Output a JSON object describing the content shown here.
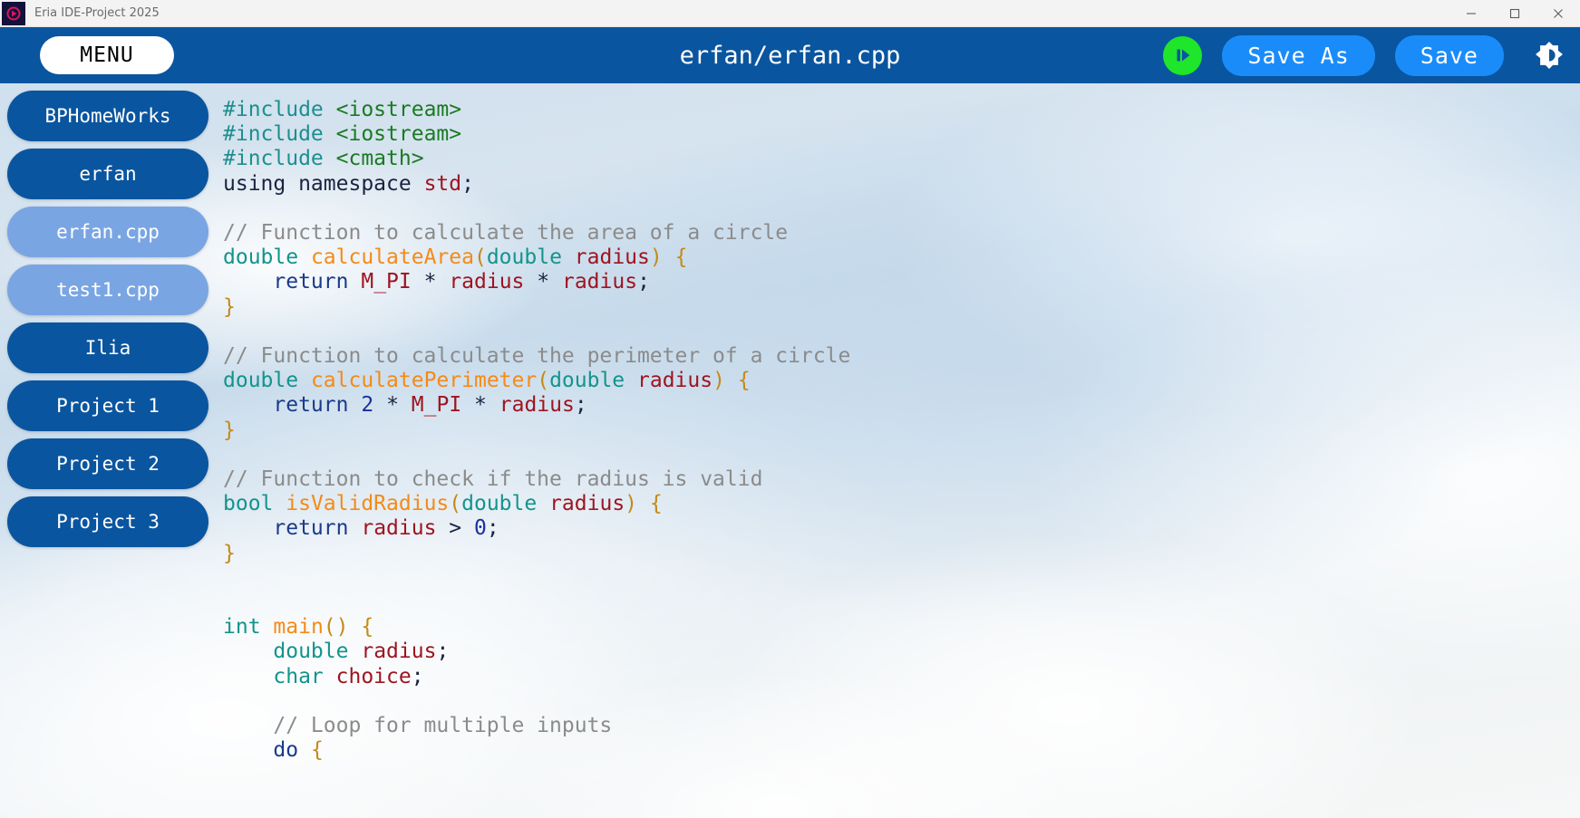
{
  "window": {
    "title": "Eria IDE-Project 2025",
    "icon": "app-logo-icon",
    "controls": {
      "minimize": "minimize-icon",
      "maximize": "maximize-icon",
      "close": "close-icon"
    }
  },
  "toolbar": {
    "menu_label": "MENU",
    "file_title": "erfan/erfan.cpp",
    "run_icon": "run-play-icon",
    "save_as_label": "Save As",
    "save_label": "Save",
    "theme_icon": "brightness-toggle-icon",
    "colors": {
      "bar_background": "#0a559f",
      "menu_background": "#ffffff",
      "pill_background": "#1a8cfa",
      "run_background": "#1fe62a"
    }
  },
  "sidebar": {
    "items": [
      {
        "label": "BPHomeWorks",
        "type": "folder"
      },
      {
        "label": "erfan",
        "type": "folder"
      },
      {
        "label": "erfan.cpp",
        "type": "file"
      },
      {
        "label": "test1.cpp",
        "type": "file"
      },
      {
        "label": "Ilia",
        "type": "folder"
      },
      {
        "label": "Project 1",
        "type": "folder"
      },
      {
        "label": "Project 2",
        "type": "folder"
      },
      {
        "label": "Project 3",
        "type": "folder"
      }
    ],
    "colors": {
      "folder": "#0a559f",
      "file": "#7aa5e3"
    }
  },
  "editor": {
    "language": "cpp",
    "lines": [
      [
        [
          "#include",
          "pre"
        ],
        [
          " ",
          "plain"
        ],
        [
          "<iostream>",
          "hdr"
        ]
      ],
      [
        [
          "#include",
          "pre"
        ],
        [
          " ",
          "plain"
        ],
        [
          "<iostream>",
          "hdr"
        ]
      ],
      [
        [
          "#include",
          "pre"
        ],
        [
          " ",
          "plain"
        ],
        [
          "<cmath>",
          "hdr"
        ]
      ],
      [
        [
          "using namespace ",
          "plain"
        ],
        [
          "std",
          "var"
        ],
        [
          ";",
          "plain"
        ]
      ],
      [
        [
          "",
          "plain"
        ]
      ],
      [
        [
          "// Function to calculate the area of a circle",
          "cmt"
        ]
      ],
      [
        [
          "double",
          "type"
        ],
        [
          " ",
          "plain"
        ],
        [
          "calculateArea",
          "fn"
        ],
        [
          "(",
          "brace"
        ],
        [
          "double",
          "type"
        ],
        [
          " ",
          "plain"
        ],
        [
          "radius",
          "var"
        ],
        [
          ")",
          "brace"
        ],
        [
          " ",
          "plain"
        ],
        [
          "{",
          "brace"
        ]
      ],
      [
        [
          "    ",
          "plain"
        ],
        [
          "return",
          "kw"
        ],
        [
          " ",
          "plain"
        ],
        [
          "M_PI",
          "var"
        ],
        [
          " ",
          "plain"
        ],
        [
          "*",
          "plain"
        ],
        [
          " ",
          "plain"
        ],
        [
          "radius",
          "var"
        ],
        [
          " ",
          "plain"
        ],
        [
          "*",
          "plain"
        ],
        [
          " ",
          "plain"
        ],
        [
          "radius",
          "var"
        ],
        [
          ";",
          "plain"
        ]
      ],
      [
        [
          "}",
          "brace"
        ]
      ],
      [
        [
          "",
          "plain"
        ]
      ],
      [
        [
          "// Function to calculate the perimeter of a circle",
          "cmt"
        ]
      ],
      [
        [
          "double",
          "type"
        ],
        [
          " ",
          "plain"
        ],
        [
          "calculatePerimeter",
          "fn"
        ],
        [
          "(",
          "brace"
        ],
        [
          "double",
          "type"
        ],
        [
          " ",
          "plain"
        ],
        [
          "radius",
          "var"
        ],
        [
          ")",
          "brace"
        ],
        [
          " ",
          "plain"
        ],
        [
          "{",
          "brace"
        ]
      ],
      [
        [
          "    ",
          "plain"
        ],
        [
          "return",
          "kw"
        ],
        [
          " ",
          "plain"
        ],
        [
          "2",
          "num"
        ],
        [
          " ",
          "plain"
        ],
        [
          "*",
          "plain"
        ],
        [
          " ",
          "plain"
        ],
        [
          "M_PI",
          "var"
        ],
        [
          " ",
          "plain"
        ],
        [
          "*",
          "plain"
        ],
        [
          " ",
          "plain"
        ],
        [
          "radius",
          "var"
        ],
        [
          ";",
          "plain"
        ]
      ],
      [
        [
          "}",
          "brace"
        ]
      ],
      [
        [
          "",
          "plain"
        ]
      ],
      [
        [
          "// Function to check if the radius is valid",
          "cmt"
        ]
      ],
      [
        [
          "bool",
          "type"
        ],
        [
          " ",
          "plain"
        ],
        [
          "isValidRadius",
          "fn"
        ],
        [
          "(",
          "brace"
        ],
        [
          "double",
          "type"
        ],
        [
          " ",
          "plain"
        ],
        [
          "radius",
          "var"
        ],
        [
          ")",
          "brace"
        ],
        [
          " ",
          "plain"
        ],
        [
          "{",
          "brace"
        ]
      ],
      [
        [
          "    ",
          "plain"
        ],
        [
          "return",
          "kw"
        ],
        [
          " ",
          "plain"
        ],
        [
          "radius",
          "var"
        ],
        [
          " ",
          "plain"
        ],
        [
          ">",
          "plain"
        ],
        [
          " ",
          "plain"
        ],
        [
          "0",
          "num"
        ],
        [
          ";",
          "plain"
        ]
      ],
      [
        [
          "}",
          "brace"
        ]
      ],
      [
        [
          "",
          "plain"
        ]
      ],
      [
        [
          "",
          "plain"
        ]
      ],
      [
        [
          "int",
          "type"
        ],
        [
          " ",
          "plain"
        ],
        [
          "main",
          "fn"
        ],
        [
          "()",
          "brace"
        ],
        [
          " ",
          "plain"
        ],
        [
          "{",
          "brace"
        ]
      ],
      [
        [
          "    ",
          "plain"
        ],
        [
          "double",
          "type"
        ],
        [
          " ",
          "plain"
        ],
        [
          "radius",
          "var"
        ],
        [
          ";",
          "plain"
        ]
      ],
      [
        [
          "    ",
          "plain"
        ],
        [
          "char",
          "type"
        ],
        [
          " ",
          "plain"
        ],
        [
          "choice",
          "var"
        ],
        [
          ";",
          "plain"
        ]
      ],
      [
        [
          "",
          "plain"
        ]
      ],
      [
        [
          "    ",
          "plain"
        ],
        [
          "// Loop for multiple inputs",
          "cmt"
        ]
      ],
      [
        [
          "    ",
          "plain"
        ],
        [
          "do",
          "kw"
        ],
        [
          " ",
          "plain"
        ],
        [
          "{",
          "brace"
        ]
      ]
    ]
  }
}
